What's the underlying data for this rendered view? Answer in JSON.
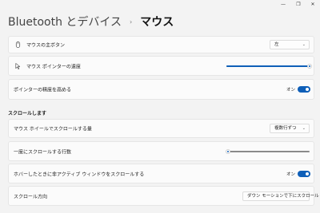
{
  "window_controls": {
    "minimize": "—",
    "maximize": "❐",
    "close": "✕"
  },
  "breadcrumb": {
    "parent": "Bluetooth とデバイス",
    "separator": "›",
    "current": "マウス"
  },
  "settings": {
    "primary_button": {
      "label": "マウスの主ボタン",
      "value": "左",
      "icon": "mouse-icon"
    },
    "pointer_speed": {
      "label": "マウス ポインターの速度",
      "icon": "pointer-icon",
      "level": 1.0
    },
    "enhance_precision": {
      "label": "ポインターの精度を高める",
      "state_label": "オン",
      "on": true
    }
  },
  "scrolling": {
    "section_title": "スクロールします",
    "wheel_scroll": {
      "label": "マウス ホイールでスクロールする量",
      "value": "複数行ずつ"
    },
    "lines_per_scroll": {
      "label": "一度にスクロールする行数",
      "level": 0.02
    },
    "inactive_scroll": {
      "label": "ホバーしたときに非アクティブ ウィンドウをスクロールする",
      "state_label": "オン",
      "on": true
    },
    "scroll_direction": {
      "label": "スクロール方向",
      "value": "ダウン モーションで下にスクロール"
    }
  },
  "colors": {
    "accent": "#0f5fb8",
    "background": "#f3f3f3",
    "card": "#fbfbfb"
  }
}
